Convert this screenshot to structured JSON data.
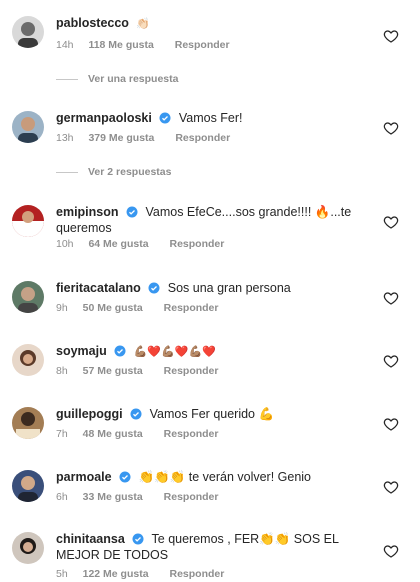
{
  "comments": [
    {
      "user": "pablostecco",
      "text": "👏🏻",
      "time": "14h",
      "likes": "118 Me gusta",
      "reply": "Responder",
      "verified": false
    },
    {
      "user": "germanpaoloski",
      "text": "Vamos Fer!",
      "time": "13h",
      "likes": "379 Me gusta",
      "reply": "Responder",
      "verified": true
    },
    {
      "user": "emipinson",
      "text": "Vamos EfeCe....sos grande!!!! 🔥...te queremos",
      "time": "10h",
      "likes": "64 Me gusta",
      "reply": "Responder",
      "verified": true
    },
    {
      "user": "fieritacatalano",
      "text": "Sos una gran persona",
      "time": "9h",
      "likes": "50 Me gusta",
      "reply": "Responder",
      "verified": true
    },
    {
      "user": "soymaju",
      "text": "💪🏽❤️💪🏽❤️💪🏽❤️",
      "time": "8h",
      "likes": "57 Me gusta",
      "reply": "Responder",
      "verified": true
    },
    {
      "user": "guillepoggi",
      "text": "Vamos Fer querido 💪",
      "time": "7h",
      "likes": "48 Me gusta",
      "reply": "Responder",
      "verified": true
    },
    {
      "user": "parmoale",
      "text": "👏👏👏 te verán volver! Genio",
      "time": "6h",
      "likes": "33 Me gusta",
      "reply": "Responder",
      "verified": true
    },
    {
      "user": "chinitaansa",
      "text": "Te queremos , FER👏👏 SOS EL MEJOR DE TODOS",
      "time": "5h",
      "likes": "122 Me gusta",
      "reply": "Responder",
      "verified": true
    }
  ],
  "replies": [
    {
      "label": "Ver una respuesta"
    },
    {
      "label": "Ver 2 respuestas"
    }
  ],
  "icons": {
    "like": "heart-outline-icon",
    "verified": "verified-badge-icon"
  },
  "colors": {
    "verified": "#3897f0",
    "muted": "#8e8e8e",
    "text": "#262626"
  }
}
